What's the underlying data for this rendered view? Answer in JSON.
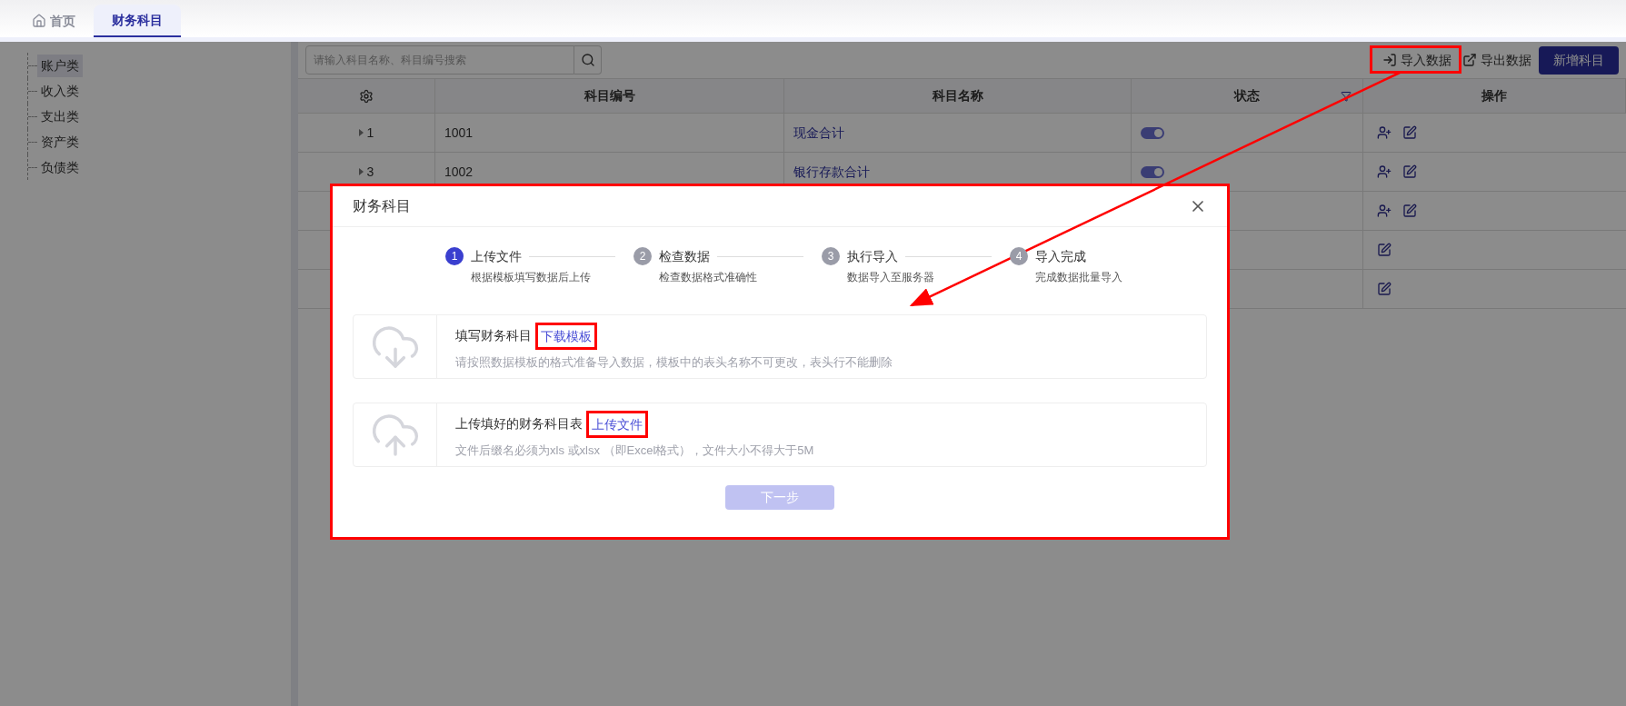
{
  "tabs": [
    {
      "label": "首页",
      "selected": false
    },
    {
      "label": "财务科目",
      "selected": true
    }
  ],
  "tree": {
    "items": [
      {
        "label": "账户类",
        "selected": true
      },
      {
        "label": "收入类",
        "selected": false
      },
      {
        "label": "支出类",
        "selected": false
      },
      {
        "label": "资产类",
        "selected": false
      },
      {
        "label": "负债类",
        "selected": false
      }
    ]
  },
  "search": {
    "placeholder": "请输入科目名称、科目编号搜索"
  },
  "toolbar": [
    {
      "kind": "import",
      "label": "导入数据"
    },
    {
      "kind": "export",
      "label": "导出数据"
    },
    {
      "kind": "primary",
      "label": "新增科目"
    }
  ],
  "table": {
    "columns": [
      {
        "kind": "settings"
      },
      {
        "label": "科目编号"
      },
      {
        "label": "科目名称"
      },
      {
        "label": "状态",
        "filter": true
      },
      {
        "label": "操作"
      }
    ],
    "rows": [
      {
        "index": "1",
        "code": "1001",
        "name": "现金合计",
        "on": true,
        "actions": [
          {
            "kind": "assign"
          },
          {
            "kind": "edit"
          }
        ]
      },
      {
        "index": "3",
        "code": "1002",
        "name": "银行存款合计",
        "on": true,
        "actions": [
          {
            "kind": "assign"
          },
          {
            "kind": "edit"
          }
        ]
      },
      {
        "actions": [
          {
            "kind": "assign"
          },
          {
            "kind": "edit"
          }
        ]
      },
      {
        "actions": [
          {
            "kind": "edit"
          }
        ]
      },
      {
        "actions": [
          {
            "kind": "edit"
          }
        ]
      }
    ]
  },
  "modal": {
    "title": "财务科目",
    "steps": [
      {
        "number": "1",
        "title": "上传文件",
        "desc": "根据模板填写数据后上传",
        "selected": true
      },
      {
        "number": "2",
        "title": "检查数据",
        "desc": "检查数据格式准确性",
        "selected": false
      },
      {
        "number": "3",
        "title": "执行导入",
        "desc": "数据导入至服务器",
        "selected": false
      },
      {
        "number": "4",
        "title": "导入完成",
        "desc": "完成数据批量导入",
        "selected": false
      }
    ],
    "cards": [
      {
        "kind": "download",
        "text": "填写财务科目",
        "link": "下载模板",
        "hint": "请按照数据模板的格式准备导入数据，模板中的表头名称不可更改，表头行不能删除"
      },
      {
        "kind": "upload",
        "text": "上传填好的财务科目表",
        "link": "上传文件",
        "hint": "文件后缀名必须为xls 或xlsx （即Excel格式），文件大小不得大于5M"
      }
    ],
    "next_button": {
      "label": "下一步",
      "disabled": true
    }
  }
}
